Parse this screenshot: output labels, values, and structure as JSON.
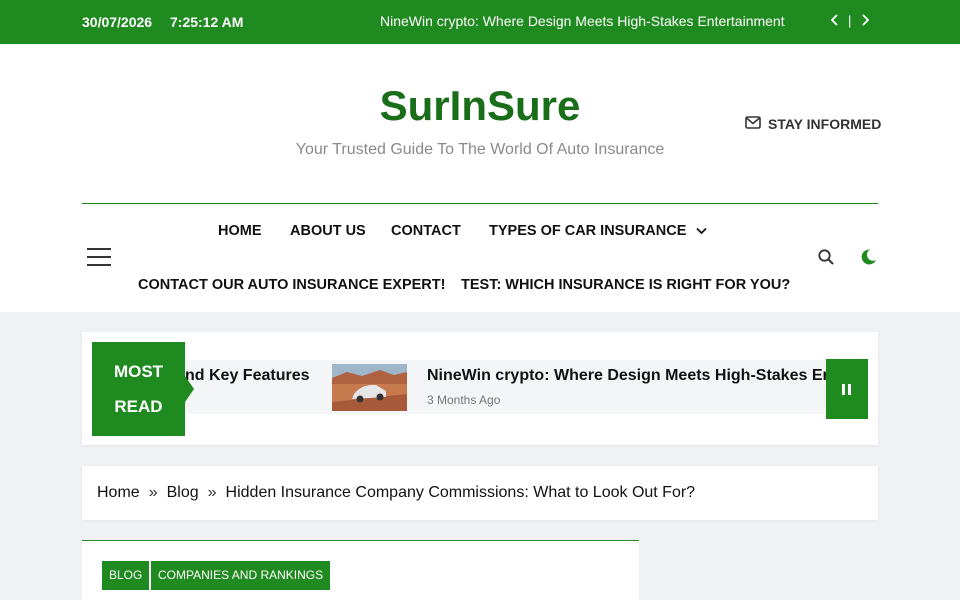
{
  "topbar": {
    "date": "30/07/2026",
    "time": "7:25:12 AM",
    "ticker": "NineWin crypto: Where Design Meets High-Stakes Entertainment",
    "separator": "|",
    "prev_icon": "chevron-left-icon",
    "next_icon": "chevron-right-icon"
  },
  "header": {
    "site_title": "SurInSure",
    "tagline": "Your Trusted Guide To The World Of Auto Insurance",
    "stay_informed": "STAY INFORMED",
    "stay_icon": "envelope-icon"
  },
  "nav": {
    "items": [
      {
        "label": "HOME"
      },
      {
        "label": "ABOUT US"
      },
      {
        "label": "CONTACT"
      },
      {
        "label": "TYPES OF CAR INSURANCE"
      },
      {
        "label": "CONTACT OUR AUTO INSURANCE EXPERT!"
      },
      {
        "label": "TEST: WHICH INSURANCE IS RIGHT FOR YOU?"
      }
    ],
    "menu_icon": "hamburger-menu-icon",
    "search_icon": "search-icon",
    "dark_mode_icon": "moon-icon"
  },
  "most_read": {
    "label_line1": "MOST",
    "label_line2": "READ",
    "items": [
      {
        "title": "nd Key Features"
      },
      {
        "title": "NineWin crypto: Where Design Meets High-Stakes Entertainment",
        "date": "3 Months Ago"
      }
    ],
    "pause_icon": "pause-icon"
  },
  "breadcrumb": {
    "items": [
      "Home",
      "Blog",
      "Hidden Insurance Company Commissions: What to Look Out For?"
    ],
    "separator": "»"
  },
  "article": {
    "tags": [
      "BLOG",
      "COMPANIES AND RANKINGS"
    ]
  },
  "colors": {
    "brand_green": "#1f8a1f",
    "title_green": "#1a6e1a"
  }
}
